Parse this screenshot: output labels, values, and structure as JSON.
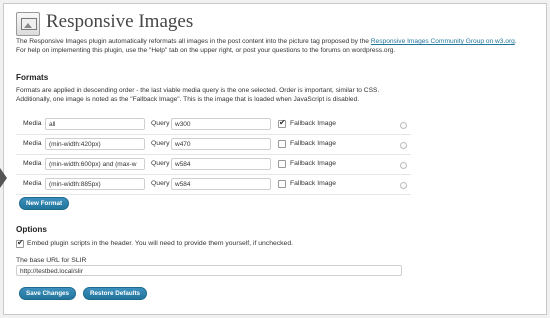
{
  "page": {
    "title": "Responsive Images",
    "description_1_pre": "The Responsive Images plugin automatically reformats all images in the post content into the picture tag proposed by the ",
    "description_1_link": "Responsive Images Community Group on w3.org",
    "description_1_post": ".",
    "description_2": "For help on implementing this plugin, use the \"Help\" tab on the upper right, or post your questions to the forums on wordpress.org."
  },
  "formats": {
    "heading": "Formats",
    "desc_1": "Formats are applied in descending order - the last viable media query is the one selected. Order is important, similar to CSS.",
    "desc_2": "Additionally, one image is noted as the \"Fallback Image\". This is the image that is loaded when JavaScript is disabled.",
    "media_label": "Media",
    "query_label": "Query",
    "fallback_label": "Fallback Image",
    "rows": [
      {
        "media": "all",
        "query": "w300",
        "fallback": true
      },
      {
        "media": "(min-width:420px)",
        "query": "w470",
        "fallback": false
      },
      {
        "media": "(min-width:600px) and (max-w",
        "query": "w584",
        "fallback": false
      },
      {
        "media": "(min-width:885px)",
        "query": "w584",
        "fallback": false
      }
    ],
    "new_format_button": "New Format"
  },
  "options": {
    "heading": "Options",
    "embed_checked": true,
    "embed_label": "Embed plugin scripts in the header. You will need to provide them yourself, if unchecked.",
    "slir_label": "The base URL for SLIR",
    "slir_value": "http://testbed.local/slir"
  },
  "actions": {
    "save": "Save Changes",
    "restore": "Restore Defaults"
  },
  "colors": {
    "accent": "#21759b",
    "button": "#3d8fbd"
  }
}
